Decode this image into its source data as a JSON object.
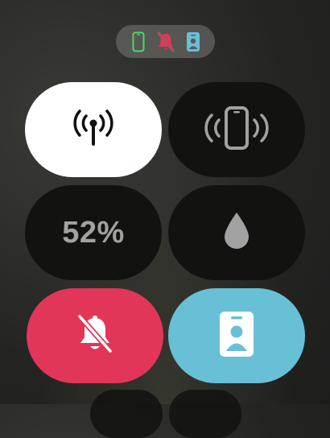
{
  "status_indicators": [
    {
      "icon": "iphone-connected-icon",
      "color": "#4cd964"
    },
    {
      "icon": "bell-slash-icon",
      "color": "#e23658"
    },
    {
      "icon": "schooltime-badge-icon",
      "color": "#68c0d6"
    }
  ],
  "tiles": {
    "cellular": {
      "icon": "cellular-antenna-icon",
      "state": "on",
      "background": "#ffffff"
    },
    "ping_iphone": {
      "icon": "ping-iphone-icon",
      "state": "off"
    },
    "battery": {
      "label": "52%"
    },
    "water_lock": {
      "icon": "water-drop-icon",
      "state": "off"
    },
    "silent_mode": {
      "icon": "bell-slash-icon",
      "state": "on",
      "background": "#e23658"
    },
    "schooltime": {
      "icon": "id-badge-icon",
      "state": "on",
      "background": "#68c0d6"
    }
  }
}
